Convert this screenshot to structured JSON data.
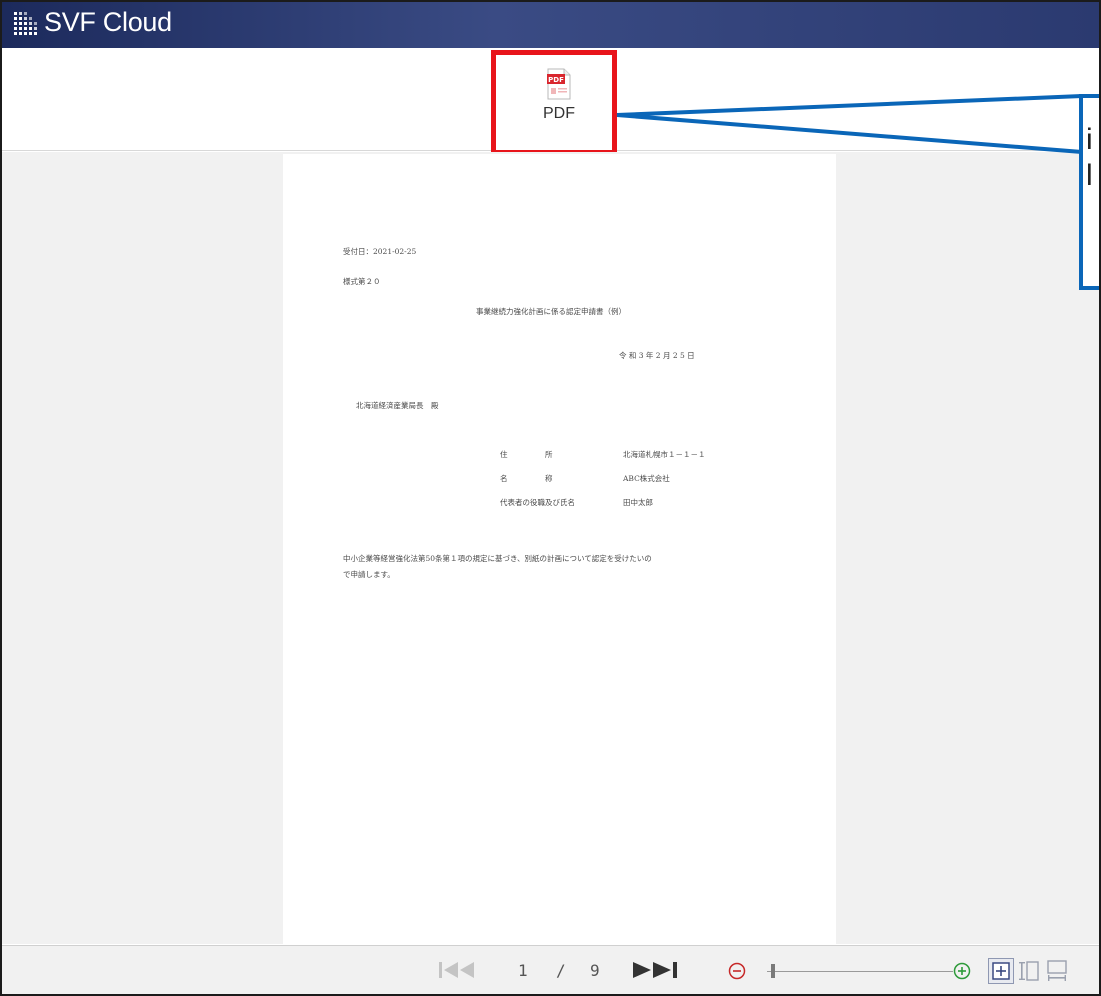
{
  "app": {
    "title": "SVF Cloud",
    "logo_icon": "svf-grid-logo-icon"
  },
  "toolbar": {
    "pdf_label": "PDF",
    "pdf_icon": "pdf-document-icon"
  },
  "document": {
    "receipt_date": "受付日：2021-02-25",
    "form_no": "様式第２０",
    "doc_title": "事業継続力強化計画に係る認定申請書（例）",
    "date": "令 和 3 年 2 月 2 5 日",
    "addressee": "北海道経済産業局長　殿",
    "address_label": "住　　　　　所",
    "address_value": "北海道札幌市１－１－１",
    "name_label": "名　　　　　称",
    "name_value": "ABC株式会社",
    "rep_label": "代表者の役職及び氏名",
    "rep_value": "田中太郎",
    "body_line1": "中小企業等経営強化法第50条第１項の規定に基づき、別紙の計画について認定を受けたいの",
    "body_line2": "で申請します。"
  },
  "footer": {
    "current_page": "1",
    "separator": "/",
    "total_pages": "9"
  },
  "callout": {
    "line1": "",
    "line2": "i",
    "line3": "l"
  },
  "colors": {
    "titlebar": "#2b3a70",
    "highlight": "#e8141b",
    "callout": "#0a66b8",
    "pdf_red": "#d9262e"
  }
}
